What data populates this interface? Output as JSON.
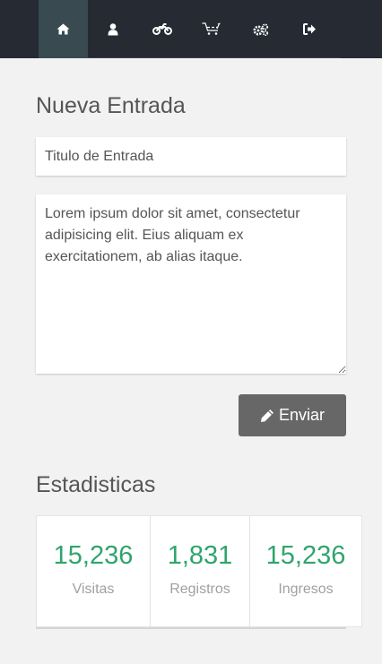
{
  "nav": {
    "items": [
      {
        "icon": "home-icon",
        "active": true
      },
      {
        "icon": "user-icon",
        "active": false
      },
      {
        "icon": "motorcycle-icon",
        "active": false
      },
      {
        "icon": "cart-icon",
        "active": false
      },
      {
        "icon": "gears-icon",
        "active": false
      },
      {
        "icon": "sign-out-icon",
        "active": false
      }
    ],
    "colors": {
      "bar": "#252a33",
      "active": "#394a51",
      "icon": "#ffffff"
    }
  },
  "new_entry": {
    "heading": "Nueva Entrada",
    "title_placeholder": "Titulo de Entrada",
    "body_text": "Lorem ipsum dolor sit amet, consectetur adipisicing elit. Eius aliquam ex exercitationem, ab alias itaque.",
    "submit_label": "Enviar",
    "submit_icon": "pencil-icon"
  },
  "stats": {
    "heading": "Estadisticas",
    "accent": "#2fa56d",
    "items": [
      {
        "value": "15,236",
        "label": "Visitas"
      },
      {
        "value": "1,831",
        "label": "Registros"
      },
      {
        "value": "15,236",
        "label": "Ingresos"
      }
    ]
  }
}
